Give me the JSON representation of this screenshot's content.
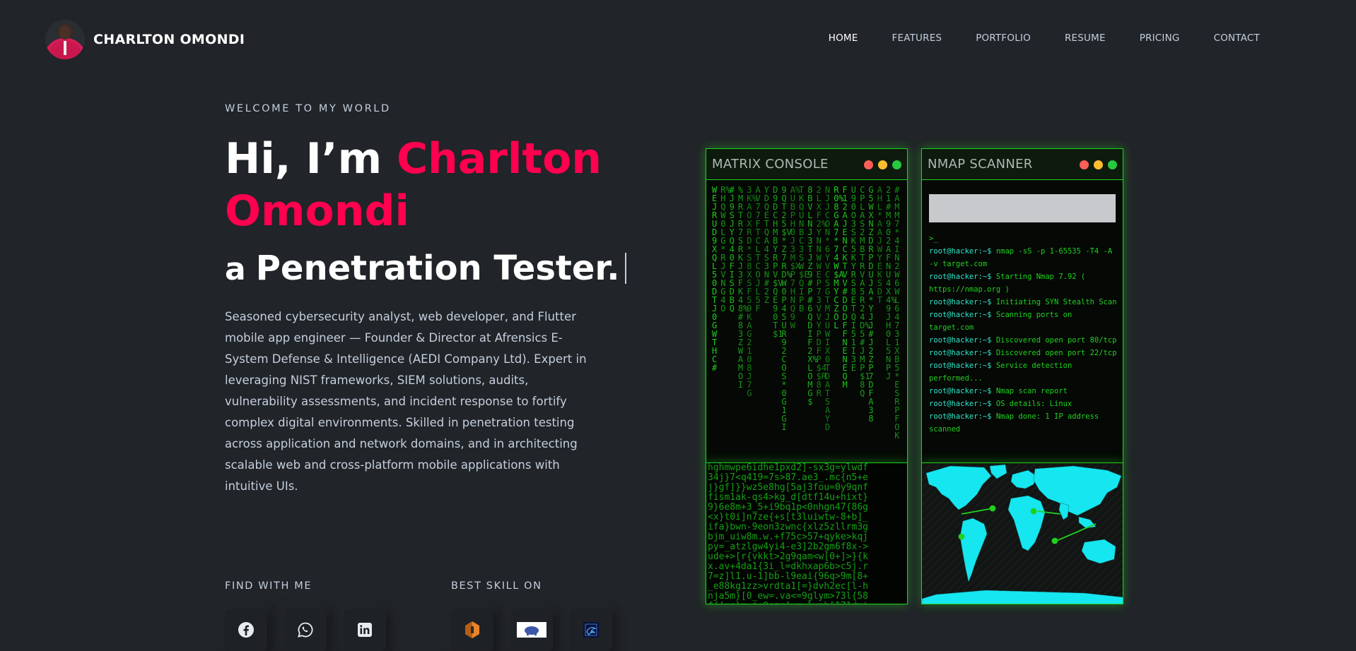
{
  "brand": {
    "name": "CHARLTON OMONDI"
  },
  "nav": {
    "items": [
      {
        "label": "HOME",
        "active": true
      },
      {
        "label": "FEATURES",
        "active": false
      },
      {
        "label": "PORTFOLIO",
        "active": false
      },
      {
        "label": "RESUME",
        "active": false
      },
      {
        "label": "PRICING",
        "active": false
      },
      {
        "label": "CONTACT",
        "active": false
      }
    ]
  },
  "hero": {
    "welcome": "WELCOME TO MY WORLD",
    "greeting": "Hi, I’m",
    "name": "Charlton Omondi",
    "role_prefix": "a",
    "role": "Penetration Tester.",
    "bio": "Seasoned cybersecurity analyst, web developer, and Flutter mobile app engineer — Founder & Director at Afrensics E-System Defense & Intelligence (AEDI Company Ltd). Expert in leveraging NIST frameworks, SIEM solutions, audits, vulnerability assessments, and incident response to fortify complex digital environments. Skilled in penetration testing across application and network domains, and in architecting scalable web and cross-platform mobile applications with intuitive UIs."
  },
  "find_with_me": {
    "label": "FIND WITH ME",
    "icons": [
      "facebook-icon",
      "whatsapp-icon",
      "linkedin-icon"
    ]
  },
  "best_skill_on": {
    "label": "BEST SKILL ON",
    "icons": [
      "burpsuite-icon",
      "metasploit-icon",
      "kali-icon"
    ]
  },
  "matrix_console": {
    "title": "MATRIX CONSOLE"
  },
  "nmap_scanner": {
    "title": "NMAP SCANNER",
    "cursor": ">_",
    "prompt": "root@hacker:~$",
    "lines": [
      "nmap -sS -p 1-65535 -T4 -A -v target.com",
      "Starting Nmap 7.92 ( https://nmap.org )",
      "Initiating SYN Stealth Scan",
      "Scanning ports on target.com",
      "Discovered open port 80/tcp",
      "Discovered open port 22/tcp",
      "Service detection performed...",
      "Nmap scan report",
      "OS details: Linux",
      "Nmap done: 1 IP address scanned"
    ]
  },
  "colors": {
    "background": "#212428",
    "accent": "#ff014f",
    "terminal_green": "#1fd11f",
    "prompt_cyan": "#2ee5c8",
    "map_cyan": "#16e6f0"
  }
}
